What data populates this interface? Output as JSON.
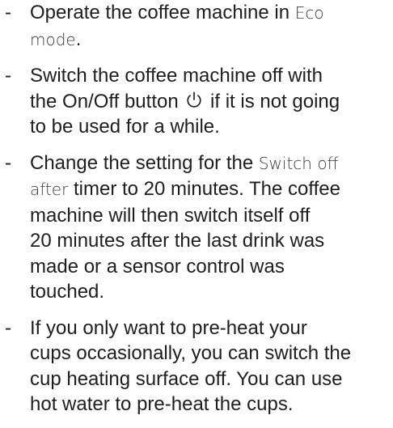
{
  "bullet": "-",
  "items": [
    {
      "parts": [
        {
          "t": "Operate the coffee machine in "
        },
        {
          "d": "Eco"
        },
        {
          "br": true
        },
        {
          "d": "mode"
        },
        {
          "t": "."
        }
      ]
    },
    {
      "parts": [
        {
          "t": "Switch the coffee machine off with"
        },
        {
          "br": true
        },
        {
          "t": "the On/Off button "
        },
        {
          "icon": "power-icon"
        },
        {
          "t": " if it is not going"
        },
        {
          "br": true
        },
        {
          "t": "to be used for a while."
        }
      ]
    },
    {
      "parts": [
        {
          "t": "Change the setting for the "
        },
        {
          "d": "Switch off"
        },
        {
          "br": true
        },
        {
          "d": "after"
        },
        {
          "t": " timer to 20 minutes. The coffee"
        },
        {
          "br": true
        },
        {
          "t": "machine will then switch itself off"
        },
        {
          "br": true
        },
        {
          "t": "20 minutes after the last drink was"
        },
        {
          "br": true
        },
        {
          "t": "made or a sensor control was"
        },
        {
          "br": true
        },
        {
          "t": "touched."
        }
      ]
    },
    {
      "parts": [
        {
          "t": "If you only want to pre-heat your"
        },
        {
          "br": true
        },
        {
          "t": "cups occasionally, you can switch the"
        },
        {
          "br": true
        },
        {
          "t": "cup heating surface off. You can use"
        },
        {
          "br": true
        },
        {
          "t": "hot water to pre-heat the cups."
        }
      ]
    }
  ]
}
